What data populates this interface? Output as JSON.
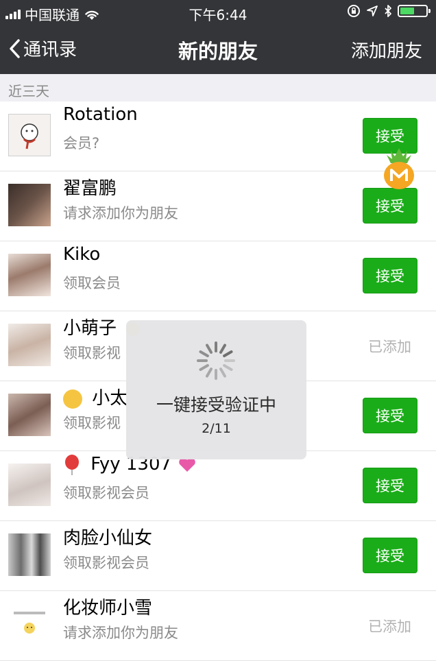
{
  "status_bar": {
    "carrier": "中国联通",
    "time": "下午6:44",
    "battery_level": 0.6
  },
  "nav": {
    "back_label": "通讯录",
    "title": "新的朋友",
    "action_label": "添加朋友"
  },
  "section_header": "近三天",
  "rows": [
    {
      "name": "Rotation",
      "subtitle": "会员?",
      "status": "接受",
      "accepted": false
    },
    {
      "name": "翟富鹏",
      "subtitle": "请求添加你为朋友",
      "status": "接受",
      "accepted": false
    },
    {
      "name": "Kiko",
      "subtitle": "领取会员",
      "status": "接受",
      "accepted": false
    },
    {
      "name": "小萌子",
      "subtitle": "领取影视",
      "status": "已添加",
      "accepted": true
    },
    {
      "name": "小太",
      "subtitle": "领取影视",
      "status": "接受",
      "accepted": false
    },
    {
      "name": "Fyy 1307",
      "subtitle": "领取影视会员",
      "status": "接受",
      "accepted": false
    },
    {
      "name": "肉脸小仙女",
      "subtitle": "领取影视会员",
      "status": "接受",
      "accepted": false
    },
    {
      "name": "化妆师小雪",
      "subtitle": "请求添加你为朋友",
      "status": "已添加",
      "accepted": true
    }
  ],
  "overlay": {
    "message": "一键接受验证中",
    "progress": "2/11"
  },
  "colors": {
    "nav_bg": "#343538",
    "accept_green": "#1aad19",
    "section_bg": "#efeff4"
  }
}
